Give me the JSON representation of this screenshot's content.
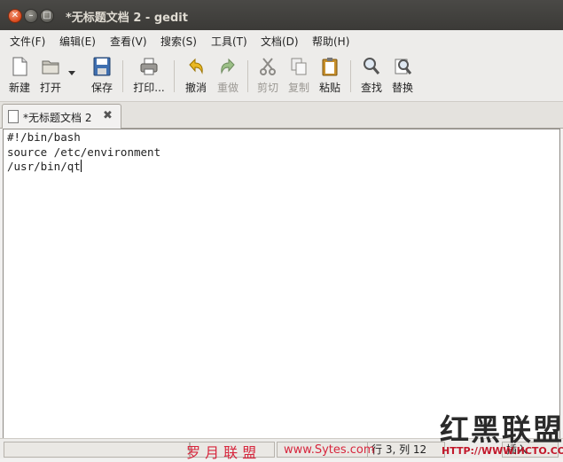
{
  "window": {
    "title": "*无标题文档 2 - gedit"
  },
  "menu": [
    "文件(F)",
    "编辑(E)",
    "查看(V)",
    "搜索(S)",
    "工具(T)",
    "文档(D)",
    "帮助(H)"
  ],
  "toolbar": {
    "new": "新建",
    "open": "打开",
    "save": "保存",
    "print": "打印...",
    "undo": "撤消",
    "redo": "重做",
    "cut": "剪切",
    "copy": "复制",
    "paste": "粘贴",
    "find": "查找",
    "replace": "替换"
  },
  "tab": {
    "label": "*无标题文档 2"
  },
  "editor": {
    "lines": [
      "#!/bin/bash",
      "source /etc/environment",
      "/usr/bin/qt"
    ]
  },
  "status": {
    "position": "行 3, 列 12",
    "mode": "插入"
  },
  "watermark": {
    "logo": "红黑联盟",
    "url": "HTTP://WWW.HCTO.COM",
    "left_text": "罗 月 联 盟",
    "mid_text": "www.Sytes.com"
  }
}
